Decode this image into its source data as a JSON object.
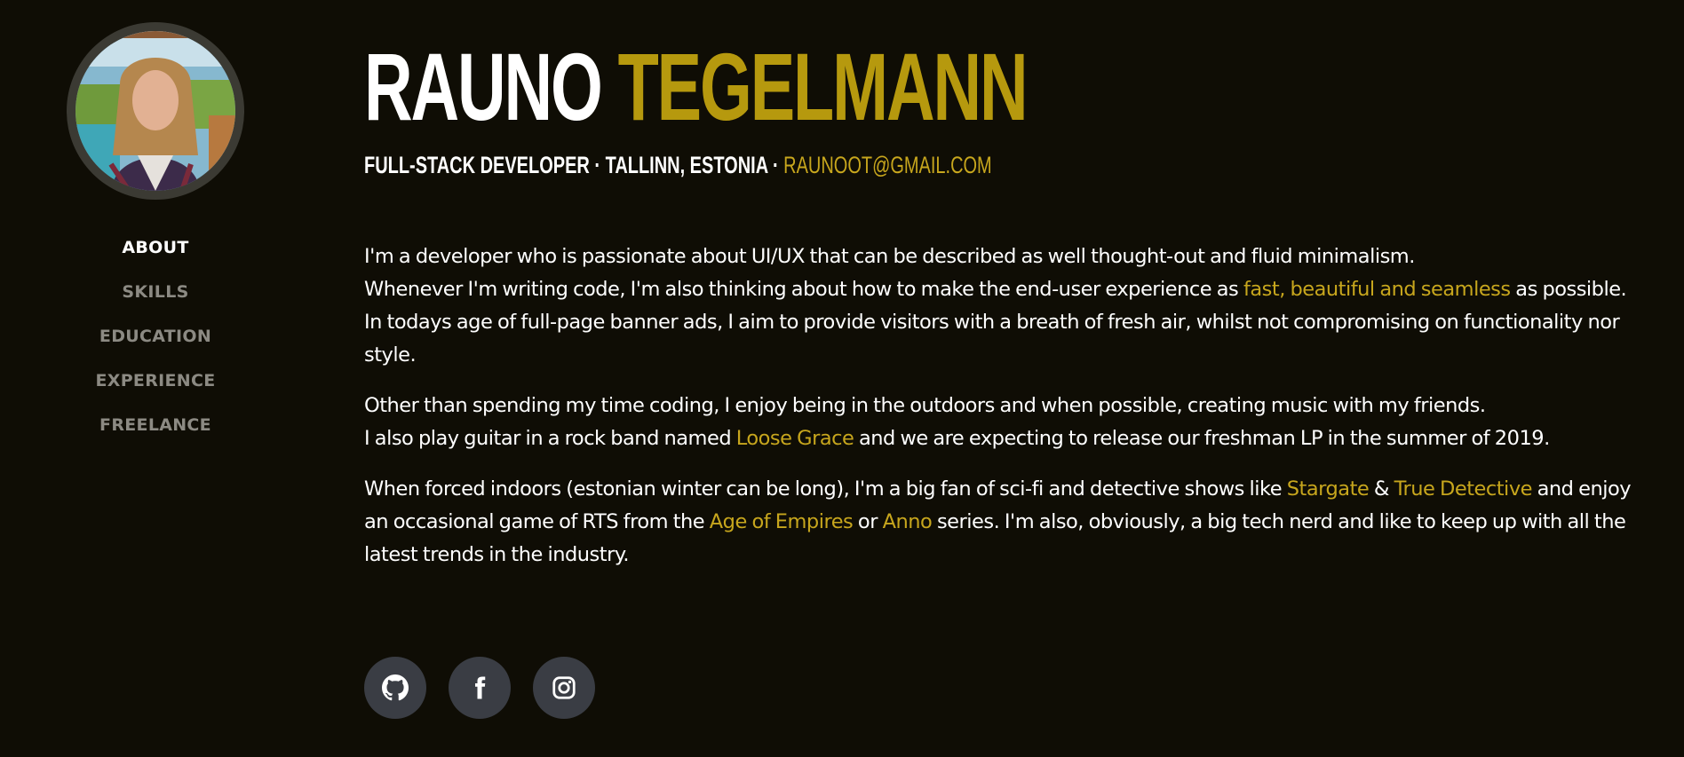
{
  "profile": {
    "first_name": "RAUNO",
    "last_name": "TEGELMANN",
    "role": "FULL-STACK DEVELOPER",
    "location": "TALLINN, ESTONIA",
    "separator": "·",
    "email": "RAUNOOT@GMAIL.COM"
  },
  "nav": {
    "items": [
      {
        "label": "ABOUT",
        "active": true
      },
      {
        "label": "SKILLS",
        "active": false
      },
      {
        "label": "EDUCATION",
        "active": false
      },
      {
        "label": "EXPERIENCE",
        "active": false
      },
      {
        "label": "FREELANCE",
        "active": false
      }
    ]
  },
  "about": {
    "p1": {
      "line1": "I'm a developer who is passionate about UI/UX that can be described as well thought-out and fluid minimalism.",
      "text_a": "Whenever I'm writing code, I'm also thinking about how to make the end-user experience as ",
      "link": "fast, beautiful and seamless",
      "text_b": " as possible. In todays age of full-page banner ads, I aim to provide visitors with a breath of fresh air, whilst not compromising on functionality nor style."
    },
    "p2": {
      "line1": "Other than spending my time coding, I enjoy being in the outdoors and when possible, creating music with my friends.",
      "text_a": "I also play guitar in a rock band named ",
      "link": "Loose Grace",
      "text_b": " and we are expecting to release our freshman LP in the summer of 2019."
    },
    "p3": {
      "text_a": "When forced indoors (estonian winter can be long), I'm a big fan of sci-fi and detective shows like ",
      "link1": "Stargate",
      "text_b": " & ",
      "link2": "True Detective",
      "text_c": " and enjoy an occasional game of RTS from the ",
      "link3": "Age of Empires",
      "text_d": " or ",
      "link4": "Anno",
      "text_e": " series. I'm also, obviously, a big tech nerd and like to keep up with all the latest trends in the industry."
    }
  },
  "social": [
    {
      "icon": "github-icon"
    },
    {
      "icon": "facebook-icon"
    },
    {
      "icon": "instagram-icon"
    }
  ],
  "colors": {
    "background": "#0f0d05",
    "accent": "#b6990e",
    "link": "#c7a61d",
    "nav_inactive": "#8c8a83",
    "social_bg": "#3a3d44"
  }
}
